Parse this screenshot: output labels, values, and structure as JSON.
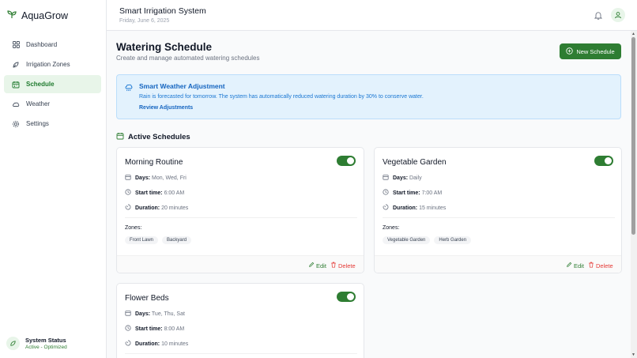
{
  "app": {
    "name": "AquaGrow"
  },
  "sidebar": {
    "items": [
      {
        "label": "Dashboard",
        "icon": "dashboard-icon",
        "active": false
      },
      {
        "label": "Irrigation Zones",
        "icon": "zones-icon",
        "active": false
      },
      {
        "label": "Schedule",
        "icon": "calendar-icon",
        "active": true
      },
      {
        "label": "Weather",
        "icon": "cloud-icon",
        "active": false
      },
      {
        "label": "Settings",
        "icon": "gear-icon",
        "active": false
      }
    ],
    "status": {
      "title": "System Status",
      "value": "Active - Optimized"
    }
  },
  "header": {
    "title": "Smart Irrigation System",
    "date": "Friday, June 6, 2025"
  },
  "page": {
    "title": "Watering Schedule",
    "subtitle": "Create and manage automated watering schedules",
    "new_button": "New Schedule"
  },
  "alert": {
    "title": "Smart Weather Adjustment",
    "text": "Rain is forecasted for tomorrow. The system has automatically reduced watering duration by 30% to conserve water.",
    "link": "Review Adjustments"
  },
  "section": {
    "title": "Active Schedules"
  },
  "labels": {
    "days": "Days:",
    "start": "Start time:",
    "duration": "Duration:",
    "zones": "Zones:",
    "edit": "Edit",
    "delete": "Delete"
  },
  "schedules": [
    {
      "name": "Morning Routine",
      "enabled": true,
      "days": "Mon, Wed, Fri",
      "start": "6:00 AM",
      "duration": "20 minutes",
      "zones": [
        "Front Lawn",
        "Backyard"
      ]
    },
    {
      "name": "Vegetable Garden",
      "enabled": true,
      "days": "Daily",
      "start": "7:00 AM",
      "duration": "15 minutes",
      "zones": [
        "Vegetable Garden",
        "Herb Garden"
      ]
    },
    {
      "name": "Flower Beds",
      "enabled": true,
      "days": "Tue, Thu, Sat",
      "start": "8:00 AM",
      "duration": "10 minutes",
      "zones": []
    }
  ],
  "colors": {
    "primary": "#2e7d32",
    "danger": "#e53935",
    "info": "#1565c0"
  }
}
